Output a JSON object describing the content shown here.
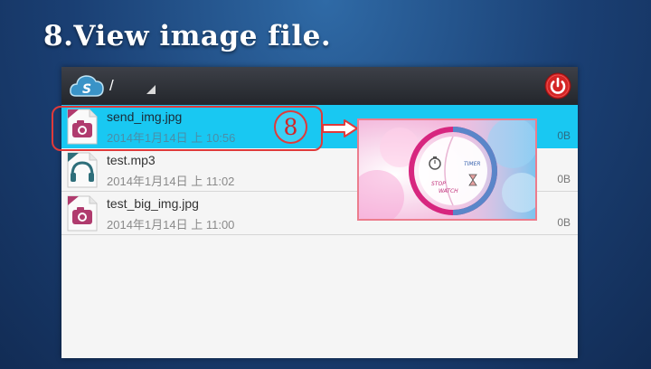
{
  "slide": {
    "title": "8.View image file."
  },
  "header": {
    "path": "/",
    "logo_letter": "S"
  },
  "files": [
    {
      "name": "send_img.jpg",
      "date": "2014年1月14日 上 10:56",
      "size": "0B",
      "type": "image",
      "selected": true
    },
    {
      "name": "test.mp3",
      "date": "2014年1月14日 上 11:02",
      "size": "0B",
      "type": "audio",
      "selected": false
    },
    {
      "name": "test_big_img.jpg",
      "date": "2014年1月14日 上 11:00",
      "size": "0B",
      "type": "image",
      "selected": false
    }
  ],
  "annotation": {
    "step": "8"
  },
  "preview": {
    "label_stop": "STOP",
    "label_watch": "WATCH",
    "label_timer": "TIMER"
  },
  "colors": {
    "selected_row": "#19c8f2",
    "annotation": "#e03a3a",
    "power": "#d42525"
  }
}
